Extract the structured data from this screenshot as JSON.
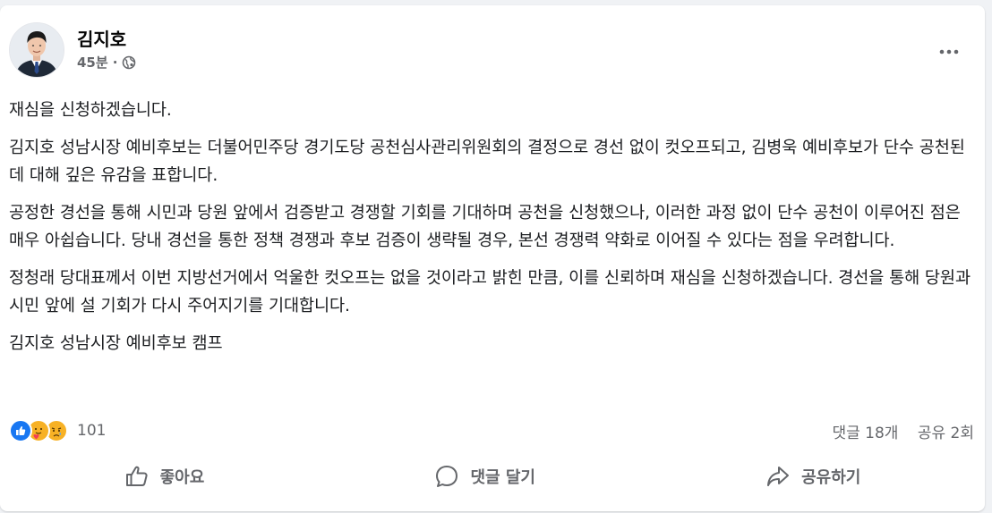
{
  "post": {
    "author": "김지호",
    "time": "45분",
    "dot": "·",
    "privacy_icon": "globe-icon",
    "more_icon": "more-options-icon",
    "paragraphs": [
      "재심을 신청하겠습니다.",
      "김지호 성남시장 예비후보는 더불어민주당 경기도당 공천심사관리위원회의 결정으로 경선 없이 컷오프되고, 김병욱 예비후보가 단수 공천된 데 대해 깊은 유감을 표합니다.",
      "공정한 경선을 통해 시민과 당원 앞에서 검증받고 경쟁할 기회를 기대하며 공천을 신청했으나, 이러한 과정 없이 단수 공천이 이루어진 점은 매우 아쉽습니다. 당내 경선을 통한 정책 경쟁과 후보 검증이 생략될 경우, 본선 경쟁력 약화로 이어질 수 있다는 점을 우려합니다.",
      "정청래 당대표께서 이번 지방선거에서 억울한 컷오프는 없을 것이라고 밝힌 만큼, 이를 신뢰하며 재심을 신청하겠습니다. 경선을 통해 당원과 시민 앞에 설 기회가 다시 주어지기를 기대합니다.",
      "김지호 성남시장 예비후보 캠프"
    ]
  },
  "stats": {
    "reaction_icons": [
      "like-icon",
      "care-icon",
      "sad-icon"
    ],
    "reaction_count": "101",
    "comments": "댓글 18개",
    "shares": "공유 2회"
  },
  "actions": {
    "like": "좋아요",
    "comment": "댓글 달기",
    "share": "공유하기"
  },
  "colors": {
    "like_blue": "#1877f2",
    "reaction_yellow": "#f7b125",
    "text_secondary": "#65676b",
    "background": "#f0f2f5"
  }
}
